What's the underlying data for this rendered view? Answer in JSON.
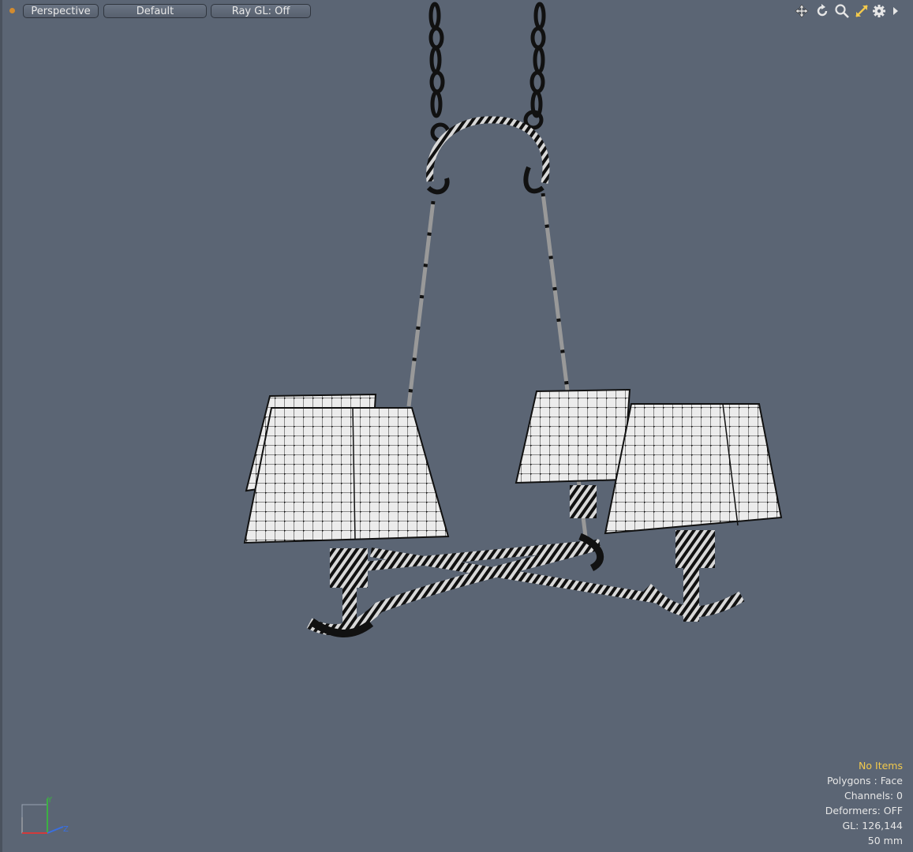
{
  "toolbar": {
    "view_label": "Perspective",
    "style_label": "Default",
    "raygl_label": "Ray GL: Off",
    "status_dot_color": "#d28b2f"
  },
  "tools": [
    "move-icon",
    "rotate-icon",
    "zoom-icon",
    "fit-icon",
    "settings-gear-icon",
    "more-arrow-icon"
  ],
  "hud": {
    "selection": "No Items",
    "polygons": "Polygons : Face",
    "channels": "Channels: 0",
    "deformers": "Deformers: OFF",
    "gl": "GL: 126,144",
    "focal": "50 mm"
  },
  "axis": {
    "y_label": "Y",
    "z_label": "Z"
  },
  "colors": {
    "background": "#5b6574",
    "accent": "#f2c94c",
    "wire": "#111111",
    "shade": "#ebebeb"
  }
}
